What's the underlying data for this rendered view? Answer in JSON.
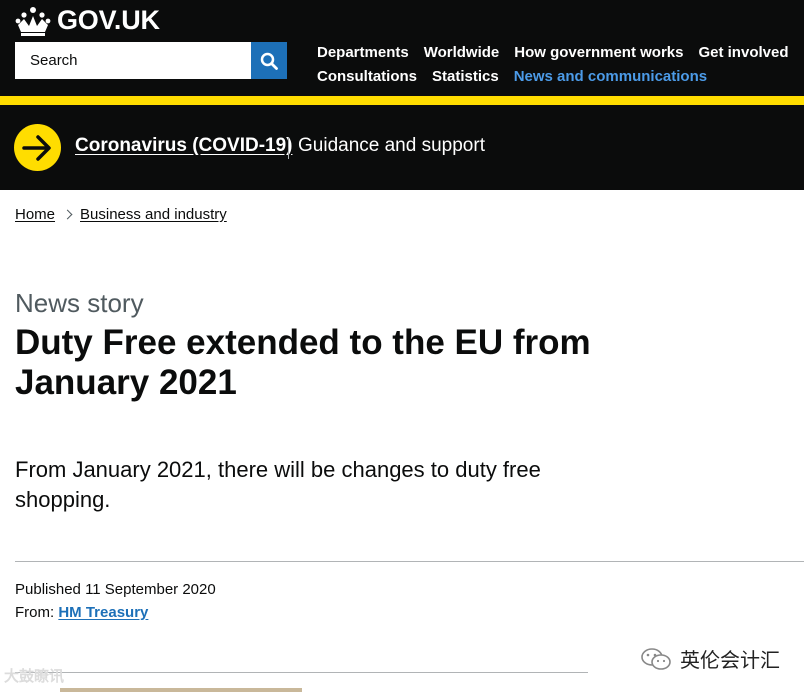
{
  "header": {
    "logo_text": "GOV.UK",
    "search_placeholder": "Search",
    "nav_row1": [
      "Departments",
      "Worldwide",
      "How government works",
      "Get involved"
    ],
    "nav_row2": [
      "Consultations",
      "Statistics",
      "News and communications"
    ],
    "active_nav": "News and communications"
  },
  "banner": {
    "link": "Coronavirus (COVID-19)",
    "guidance": "Guidance and support"
  },
  "breadcrumbs": [
    "Home",
    "Business and industry"
  ],
  "article": {
    "caption": "News story",
    "title": "Duty Free extended to the EU from January 2021",
    "lead": "From January 2021, there will be changes to duty free shopping.",
    "published_label": "Published",
    "published_date": "11 September 2020",
    "from_label": "From:",
    "from_org": "HM Treasury"
  },
  "watermarks": {
    "left": "大鼓瞭讯",
    "right": "英伦会计汇"
  },
  "colors": {
    "header_bg": "#0b0c0c",
    "yellow": "#ffdd00",
    "link_blue": "#1d70b8",
    "active_nav": "#4c9be8"
  }
}
